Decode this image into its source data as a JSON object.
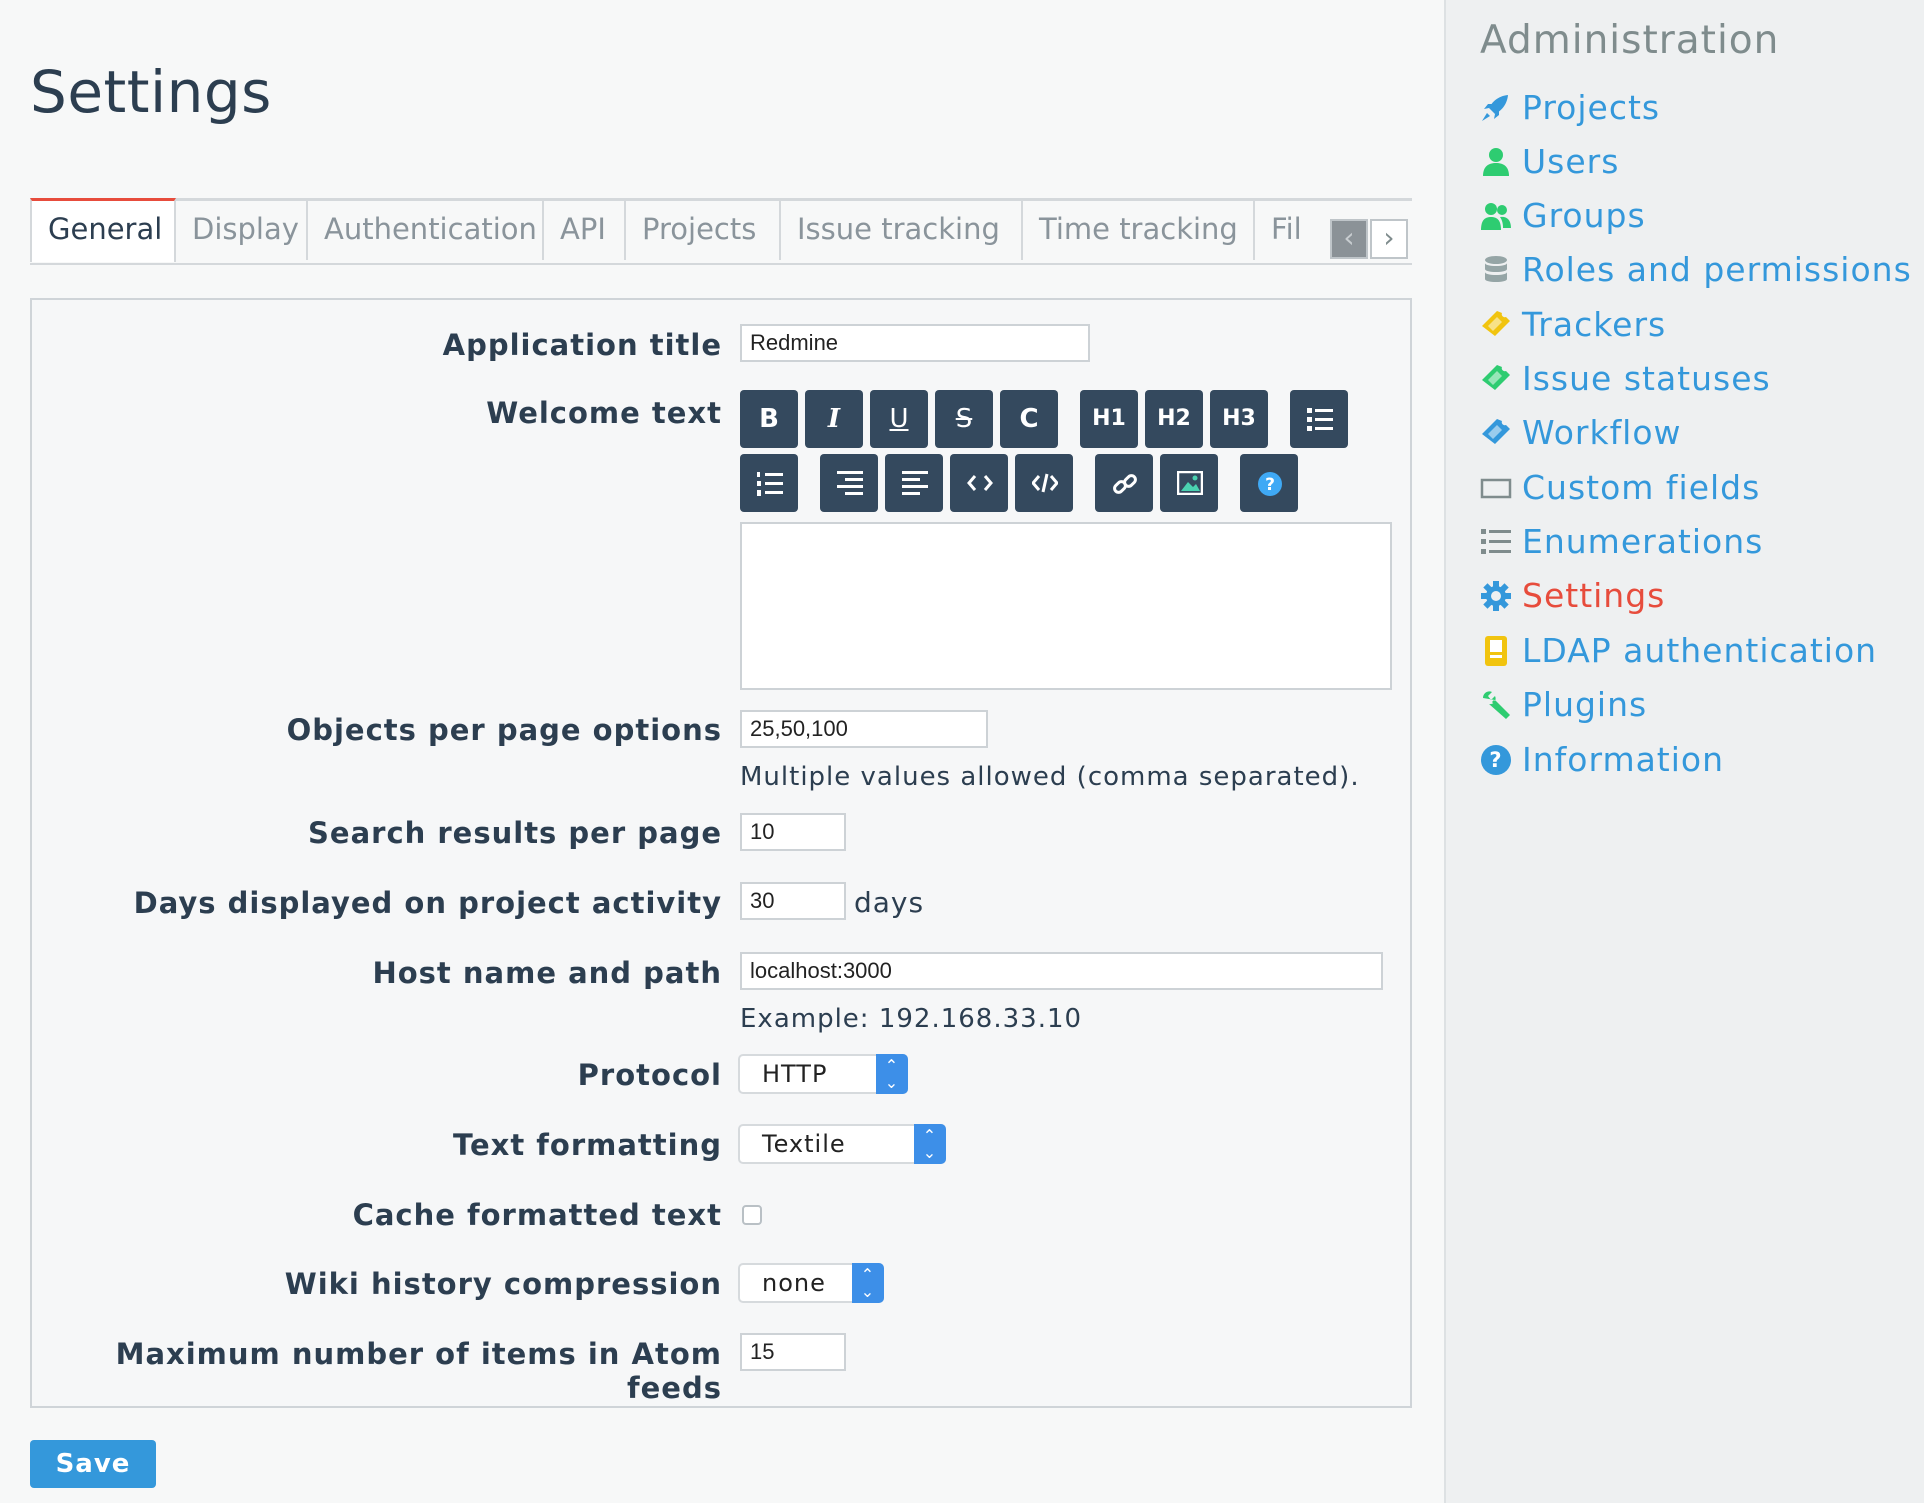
{
  "page": {
    "title": "Settings"
  },
  "tabs": [
    {
      "label": "General",
      "active": true
    },
    {
      "label": "Display"
    },
    {
      "label": "Authentication"
    },
    {
      "label": "API"
    },
    {
      "label": "Projects"
    },
    {
      "label": "Issue tracking"
    },
    {
      "label": "Time tracking"
    },
    {
      "label": "Fil"
    }
  ],
  "tab_nav": {
    "prev": "‹",
    "next": "›"
  },
  "form": {
    "application_title": {
      "label": "Application title",
      "value": "Redmine"
    },
    "welcome_text": {
      "label": "Welcome text",
      "value": "",
      "toolbar": {
        "bold": "B",
        "italic": "I",
        "underline": "U",
        "strike": "S",
        "code": "C",
        "h1": "H1",
        "h2": "H2",
        "h3": "H3"
      }
    },
    "objects_per_page": {
      "label": "Objects per page options",
      "value": "25,50,100",
      "hint": "Multiple values allowed (comma separated)."
    },
    "search_results": {
      "label": "Search results per page",
      "value": "10"
    },
    "activity_days": {
      "label": "Days displayed on project activity",
      "value": "30",
      "unit": "days"
    },
    "host_name": {
      "label": "Host name and path",
      "value": "localhost:3000",
      "hint": "Example: 192.168.33.10"
    },
    "protocol": {
      "label": "Protocol",
      "value": "HTTP"
    },
    "text_formatting": {
      "label": "Text formatting",
      "value": "Textile"
    },
    "cache_formatted": {
      "label": "Cache formatted text",
      "checked": false
    },
    "wiki_compression": {
      "label": "Wiki history compression",
      "value": "none"
    },
    "atom_items": {
      "label": "Maximum number of items in Atom feeds",
      "value": "15"
    }
  },
  "save_button": "Save",
  "sidebar": {
    "title": "Administration",
    "items": [
      {
        "label": "Projects",
        "icon": "rocket-icon",
        "color": "#3498db"
      },
      {
        "label": "Users",
        "icon": "user-icon",
        "color": "#2ecc71"
      },
      {
        "label": "Groups",
        "icon": "group-icon",
        "color": "#2ecc71"
      },
      {
        "label": "Roles and permissions",
        "icon": "database-icon",
        "color": "#95a5a6"
      },
      {
        "label": "Trackers",
        "icon": "ticket-icon",
        "color": "#f1c40f"
      },
      {
        "label": "Issue statuses",
        "icon": "ticket-icon",
        "color": "#2ecc71"
      },
      {
        "label": "Workflow",
        "icon": "ticket-icon",
        "color": "#3498db"
      },
      {
        "label": "Custom fields",
        "icon": "box-icon",
        "color": "#7f8c8d"
      },
      {
        "label": "Enumerations",
        "icon": "list-icon",
        "color": "#7f8c8d"
      },
      {
        "label": "Settings",
        "icon": "gear-icon",
        "color": "#3498db",
        "selected": true
      },
      {
        "label": "LDAP authentication",
        "icon": "ldap-icon",
        "color": "#f1c40f"
      },
      {
        "label": "Plugins",
        "icon": "wrench-icon",
        "color": "#2ecc71"
      },
      {
        "label": "Information",
        "icon": "help-icon",
        "color": "#3498db"
      }
    ]
  }
}
